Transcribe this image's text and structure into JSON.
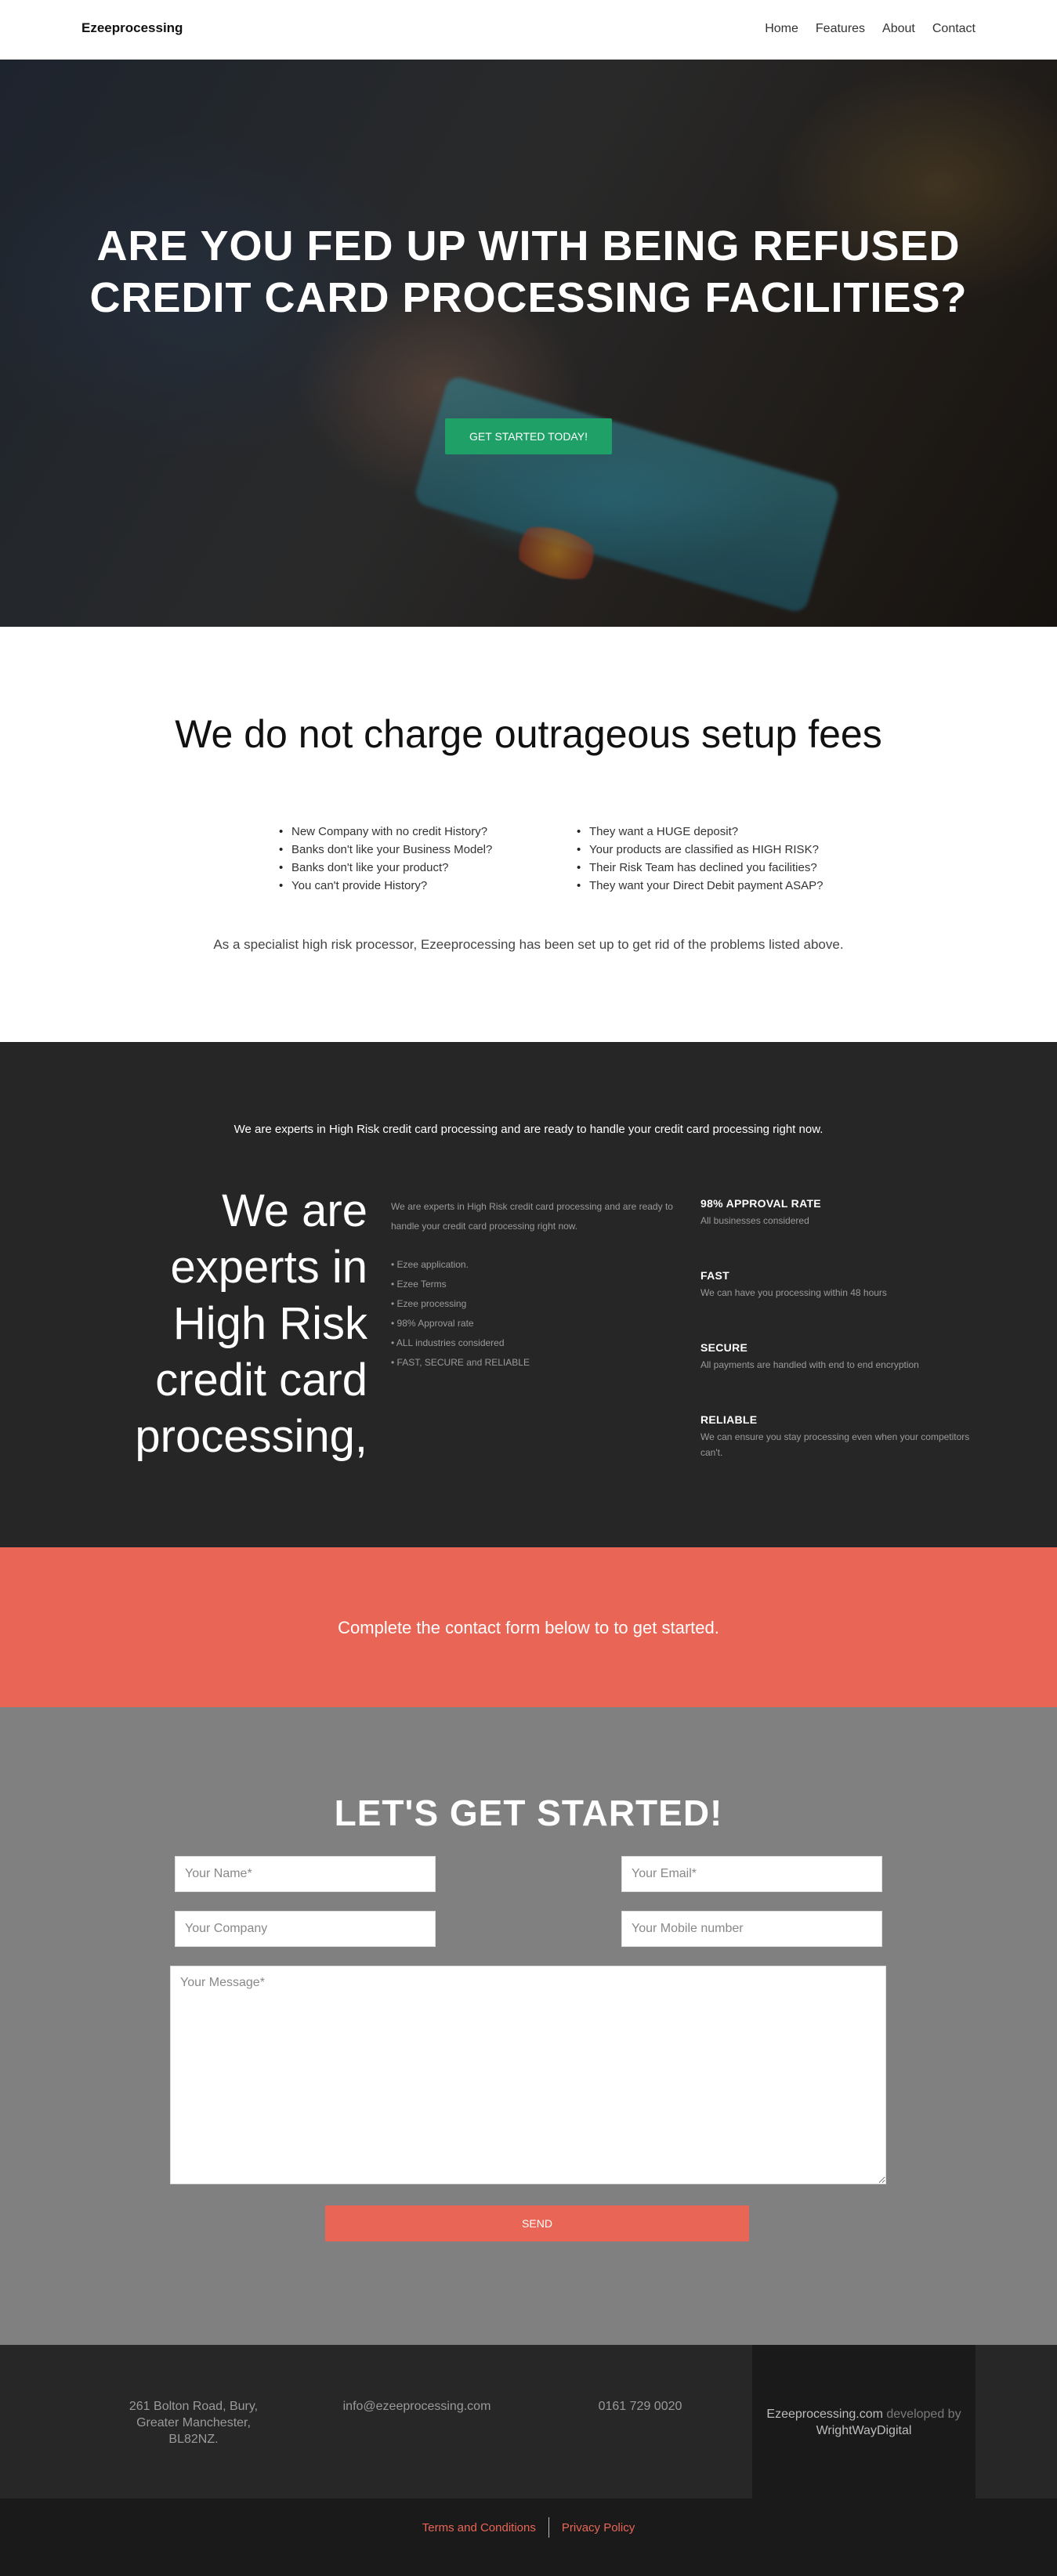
{
  "nav": {
    "brand": "Ezeeprocessing",
    "links": [
      "Home",
      "Features",
      "About",
      "Contact"
    ]
  },
  "hero": {
    "heading": "ARE YOU FED UP WITH BEING REFUSED CREDIT CARD PROCESSING FACILITIES?",
    "cta_label": "GET STARTED TODAY!"
  },
  "setup": {
    "heading": "We do not charge outrageous setup fees",
    "left_list": [
      "New Company with no credit History?",
      "Banks don't like your Business Model?",
      "Banks don't like your product?",
      "You can't provide History?"
    ],
    "right_list": [
      "They want a HUGE deposit?",
      "Your products are classified as HIGH RISK?",
      "Their Risk Team has declined you facilities?",
      "They want your Direct Debit payment ASAP?"
    ],
    "note": "As a specialist high risk processor, Ezeeprocessing has been set up to get rid of the problems listed above."
  },
  "experts": {
    "intro": "We are experts in High Risk credit card processing and are ready to handle your credit card processing right now.",
    "big_heading": "We are experts in High Risk credit card processing,",
    "description": "We are experts in High Risk credit card processing and are ready to handle your credit card processing right now.",
    "bullets": [
      "• Ezee application.",
      "• Ezee Terms",
      "• Ezee processing",
      "• 98% Approval rate",
      "• ALL industries considered",
      "• FAST, SECURE and RELIABLE"
    ],
    "features": [
      {
        "title": "98% APPROVAL RATE",
        "desc": "All businesses considered"
      },
      {
        "title": "FAST",
        "desc": "We can have you processing within 48 hours"
      },
      {
        "title": "SECURE",
        "desc": "All payments are handled with end to end encryption"
      },
      {
        "title": "RELIABLE",
        "desc": "We can ensure you stay processing even when your competitors can't."
      }
    ]
  },
  "contact_banner": "Complete the contact form below to to get started.",
  "form": {
    "heading": "LET'S GET STARTED!",
    "name_placeholder": "Your Name*",
    "email_placeholder": "Your Email*",
    "company_placeholder": "Your Company",
    "mobile_placeholder": "Your Mobile number",
    "message_placeholder": "Your Message*",
    "send_label": "SEND"
  },
  "footer": {
    "address": "261 Bolton Road, Bury, Greater Manchester, BL82NZ.",
    "email": "info@ezeeprocessing.com",
    "phone": "0161 729 0020",
    "dev_site": "Ezeeprocessing.com",
    "dev_text": " developed by ",
    "dev_name": "WrightWayDigital",
    "terms": "Terms and Conditions",
    "privacy": "Privacy Policy"
  },
  "colors": {
    "cta_green": "#1fa067",
    "coral": "#e96656",
    "dark_bg": "#262626",
    "form_bg": "#808080"
  }
}
